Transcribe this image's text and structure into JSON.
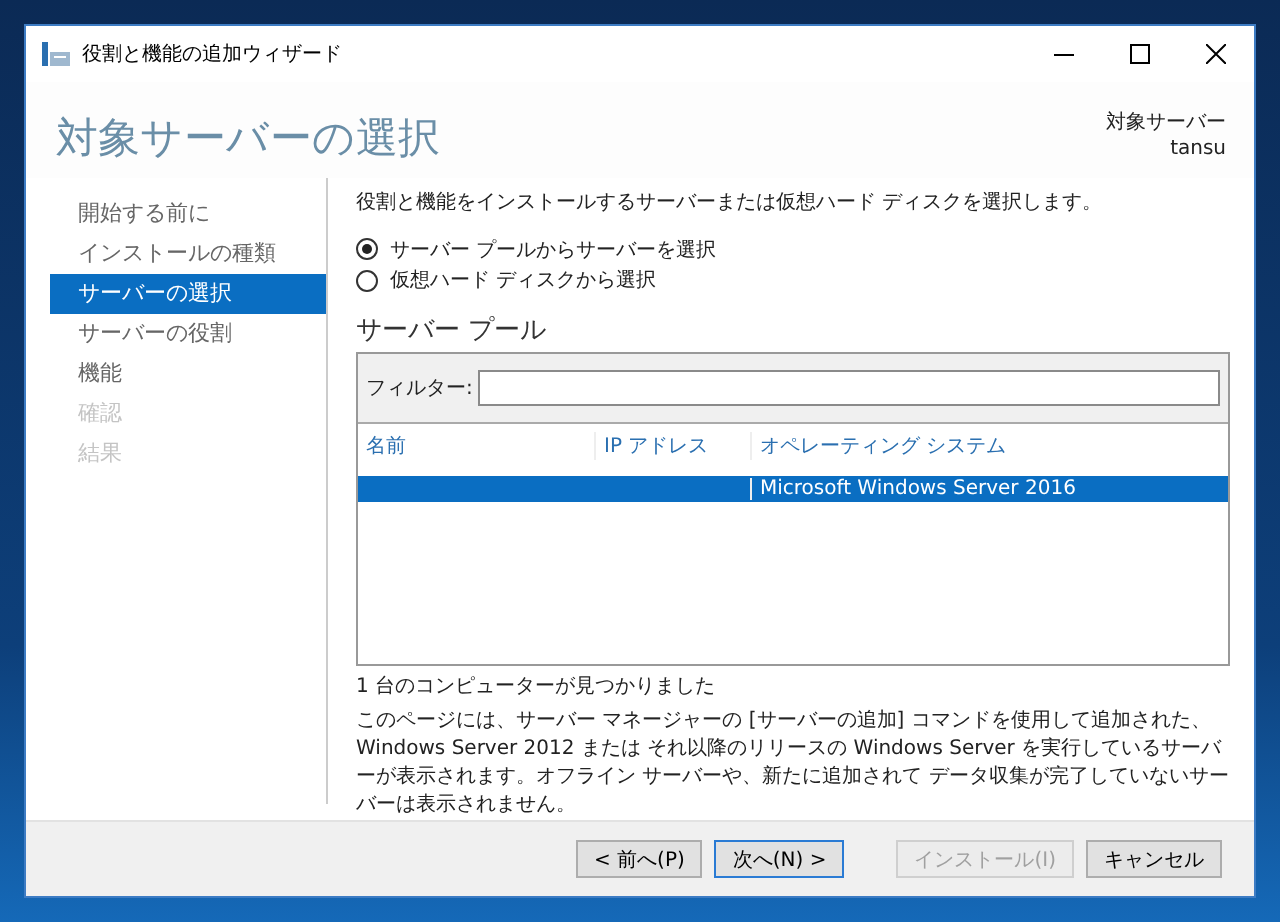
{
  "window": {
    "title": "役割と機能の追加ウィザード"
  },
  "header": {
    "title": "対象サーバーの選択",
    "target_label": "対象サーバー",
    "target_value": "tansu"
  },
  "nav": [
    {
      "label": "開始する前に",
      "selected": false,
      "disabled": false
    },
    {
      "label": "インストールの種類",
      "selected": false,
      "disabled": false
    },
    {
      "label": "サーバーの選択",
      "selected": true,
      "disabled": false
    },
    {
      "label": "サーバーの役割",
      "selected": false,
      "disabled": false
    },
    {
      "label": "機能",
      "selected": false,
      "disabled": false
    },
    {
      "label": "確認",
      "selected": false,
      "disabled": true
    },
    {
      "label": "結果",
      "selected": false,
      "disabled": true
    }
  ],
  "intro": "役割と機能をインストールするサーバーまたは仮想ハード ディスクを選択します。",
  "options": [
    {
      "label": "サーバー プールからサーバーを選択",
      "selected": true
    },
    {
      "label": "仮想ハード ディスクから選択",
      "selected": false
    }
  ],
  "pool": {
    "title": "サーバー プール",
    "filter_label": "フィルター:",
    "columns": [
      "名前",
      "IP アドレス",
      "オペレーティング システム"
    ],
    "rows": [
      {
        "name": "",
        "ip": "",
        "os": "Microsoft Windows Server 2016",
        "selected": true
      }
    ]
  },
  "found": "1 台のコンピューターが見つかりました",
  "note": "このページには、サーバー マネージャーの [サーバーの追加] コマンドを使用して追加された、Windows Server 2012 または それ以降のリリースの Windows Server を実行しているサーバーが表示されます。オフライン サーバーや、新たに追加されて データ収集が完了していないサーバーは表示されません。",
  "buttons": [
    {
      "label": "< 前へ(P)",
      "disabled": false,
      "default": false
    },
    {
      "label": "次へ(N) >",
      "disabled": false,
      "default": true
    },
    {
      "label": "インストール(I)",
      "disabled": true,
      "default": false
    },
    {
      "label": "キャンセル",
      "disabled": false,
      "default": false
    }
  ]
}
